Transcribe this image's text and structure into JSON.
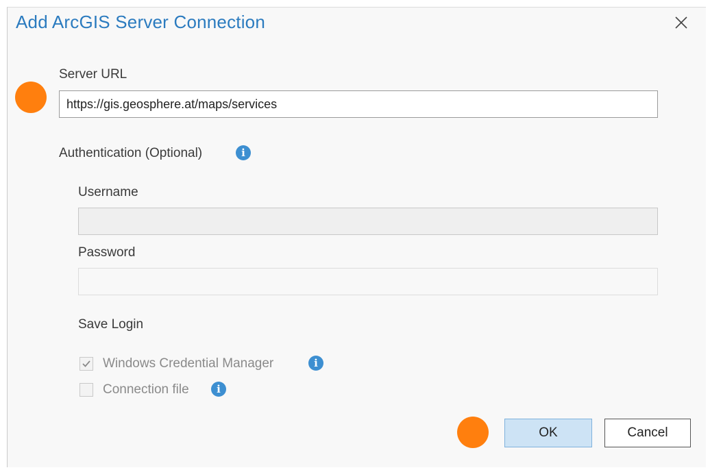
{
  "dialog": {
    "title": "Add ArcGIS Server Connection",
    "close_icon": "close-icon"
  },
  "server_url": {
    "label": "Server URL",
    "value": "https://gis.geosphere.at/maps/services"
  },
  "authentication": {
    "label": "Authentication (Optional)",
    "info_icon": "info-icon",
    "username_label": "Username",
    "username_value": "",
    "password_label": "Password",
    "password_value": ""
  },
  "save_login": {
    "label": "Save Login",
    "options": [
      {
        "label": "Windows Credential Manager",
        "checked": true,
        "enabled": false
      },
      {
        "label": "Connection file",
        "checked": false,
        "enabled": false
      }
    ]
  },
  "buttons": {
    "ok_label": "OK",
    "cancel_label": "Cancel"
  },
  "colors": {
    "title": "#2b7bbf",
    "marker": "#ff7f0e",
    "info": "#3d8fd1",
    "ok_bg": "#cde3f5",
    "ok_border": "#7fb1dc"
  }
}
